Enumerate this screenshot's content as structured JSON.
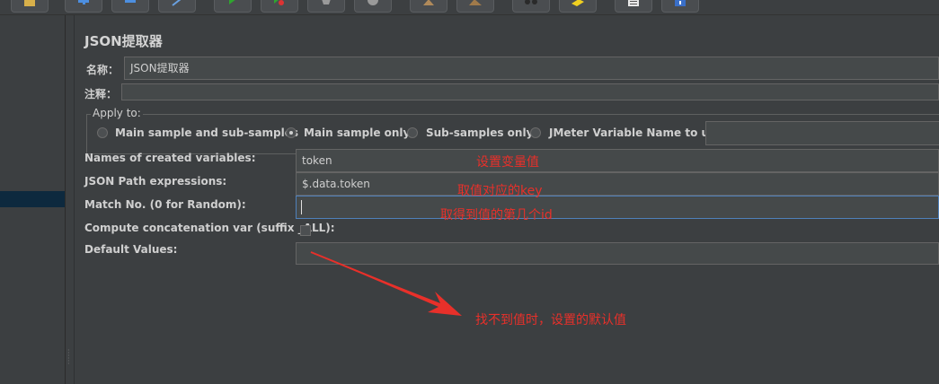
{
  "panel_title": "JSON提取器",
  "name": {
    "label": "名称：",
    "value": "JSON提取器"
  },
  "comments": {
    "label": "注释：",
    "value": ""
  },
  "apply_to": {
    "title": "Apply to:",
    "options": [
      {
        "label": "Main sample and sub-samples",
        "selected": false
      },
      {
        "label": "Main sample only",
        "selected": true
      },
      {
        "label": "Sub-samples only",
        "selected": false
      },
      {
        "label": "JMeter Variable Name to use",
        "selected": false
      }
    ],
    "variable_name_value": ""
  },
  "fields": {
    "names_label": "Names of created variables:",
    "names_value": "token",
    "json_path_label": "JSON Path expressions:",
    "json_path_value": "$.data.token",
    "match_no_label": "Match No. (0 for Random):",
    "match_no_value": "",
    "concat_label": "Compute concatenation var (suffix _ALL):",
    "concat_checked": false,
    "default_label": "Default Values:",
    "default_value": ""
  },
  "annotations": {
    "variable_note": "设置变量值",
    "key_note": "取值对应的key",
    "index_note": "取得到值的第几个id",
    "default_note": "找不到值时，设置的默认值",
    "color": "#e8302a"
  }
}
